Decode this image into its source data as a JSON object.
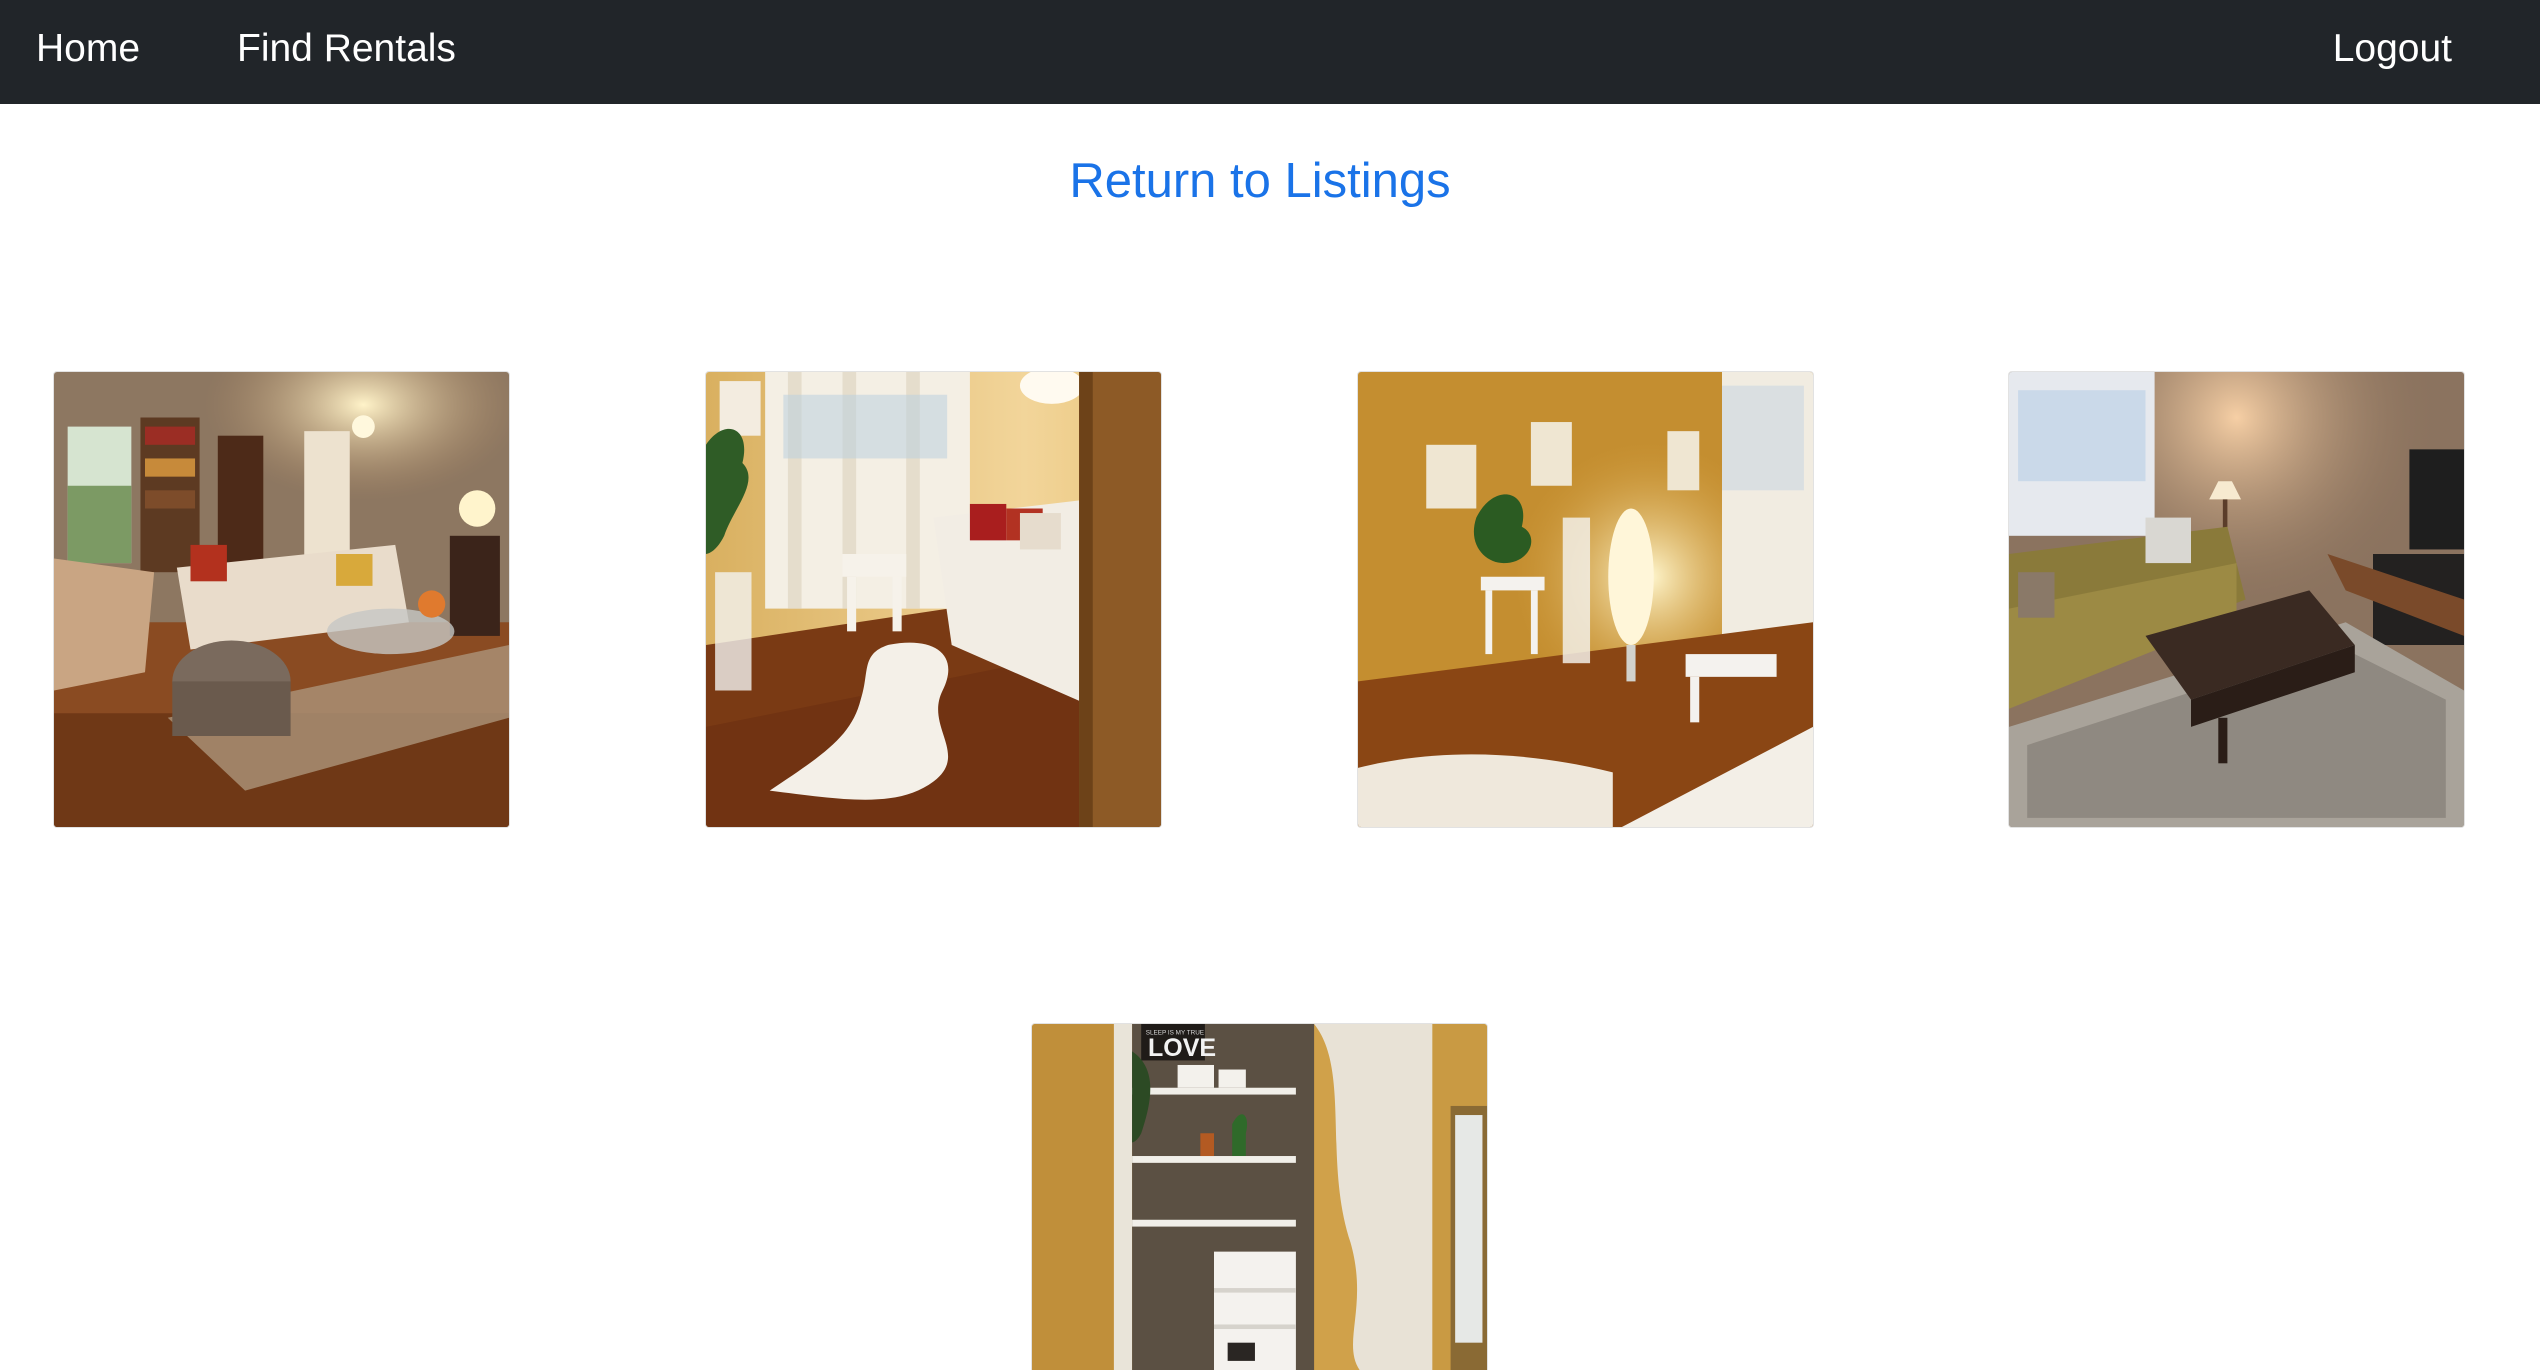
{
  "nav": {
    "home_label": "Home",
    "find_rentals_label": "Find Rentals",
    "logout_label": "Logout"
  },
  "return_link_label": "Return to Listings",
  "gallery": {
    "photos": [
      {
        "alt": "living room with sofa and ottoman"
      },
      {
        "alt": "bedroom with white rug"
      },
      {
        "alt": "bedroom with floor lamp and plant"
      },
      {
        "alt": "living room with yellow sofa and coffee table"
      },
      {
        "alt": "closet with white shelves"
      }
    ],
    "closet_sign_text": "LOVE",
    "closet_sign_small_text": "SLEEP IS MY TRUE"
  },
  "colors": {
    "navbar_bg": "#212529",
    "link_blue": "#1a73e8"
  }
}
